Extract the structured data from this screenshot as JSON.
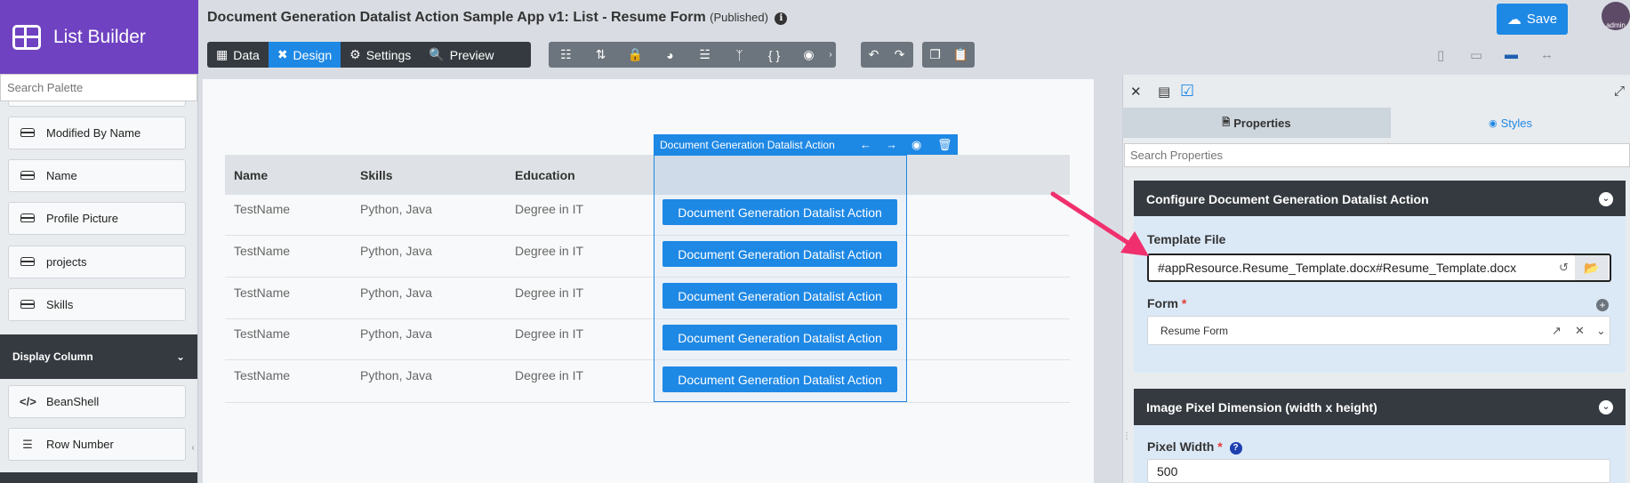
{
  "brand": {
    "title": "List Builder"
  },
  "palette": {
    "search_placeholder": "Search Palette",
    "items": [
      {
        "label": "Modified By Name",
        "icon": "hdd-icon"
      },
      {
        "label": "Name",
        "icon": "hdd-icon"
      },
      {
        "label": "Profile Picture",
        "icon": "hdd-icon"
      },
      {
        "label": "projects",
        "icon": "hdd-icon"
      },
      {
        "label": "Skills",
        "icon": "hdd-icon"
      }
    ],
    "section_title": "Display Column",
    "section_items": [
      {
        "label": "BeanShell",
        "icon": "code-icon"
      },
      {
        "label": "Row Number",
        "icon": "list-ol-icon"
      }
    ]
  },
  "header": {
    "title": "Document Generation Datalist Action Sample App v1: List - Resume Form",
    "status": "(Published)",
    "save_label": "Save",
    "avatar_text": "admin"
  },
  "toolbar": {
    "tabs": [
      {
        "label": "Data",
        "icon": "table-icon",
        "active": false
      },
      {
        "label": "Design",
        "icon": "design-icon",
        "active": true
      },
      {
        "label": "Settings",
        "icon": "gear-icon",
        "active": false
      },
      {
        "label": "Preview",
        "icon": "preview-icon",
        "active": false
      }
    ]
  },
  "grid": {
    "columns": [
      "Name",
      "Skills",
      "Education"
    ],
    "rows": [
      {
        "name": "TestName",
        "skills": "Python, Java",
        "education": "Degree in IT"
      },
      {
        "name": "TestName",
        "skills": "Python, Java",
        "education": "Degree in IT"
      },
      {
        "name": "TestName",
        "skills": "Python, Java",
        "education": "Degree in IT"
      },
      {
        "name": "TestName",
        "skills": "Python, Java",
        "education": "Degree in IT"
      },
      {
        "name": "TestName",
        "skills": "Python, Java",
        "education": "Degree in IT"
      }
    ],
    "action_label": "Document Generation Datalist Action",
    "selected_column_label": "Document Generation Datalist Action"
  },
  "properties": {
    "tab_properties": "Properties",
    "tab_styles": "Styles",
    "search_placeholder": "Search Properties",
    "section1_title": "Configure Document Generation Datalist Action",
    "template_label": "Template File",
    "template_value": "#appResource.Resume_Template.docx#Resume_Template.docx",
    "form_label": "Form",
    "form_required": "*",
    "form_value": "Resume Form",
    "section2_title": "Image Pixel Dimension (width x height)",
    "pixel_width_label": "Pixel Width",
    "pixel_width_required": "*",
    "pixel_width_value": "500"
  },
  "colors": {
    "accent": "#1e88e5",
    "brand": "#6f42c1",
    "dark": "#343a40",
    "arrow": "#f0306e"
  }
}
